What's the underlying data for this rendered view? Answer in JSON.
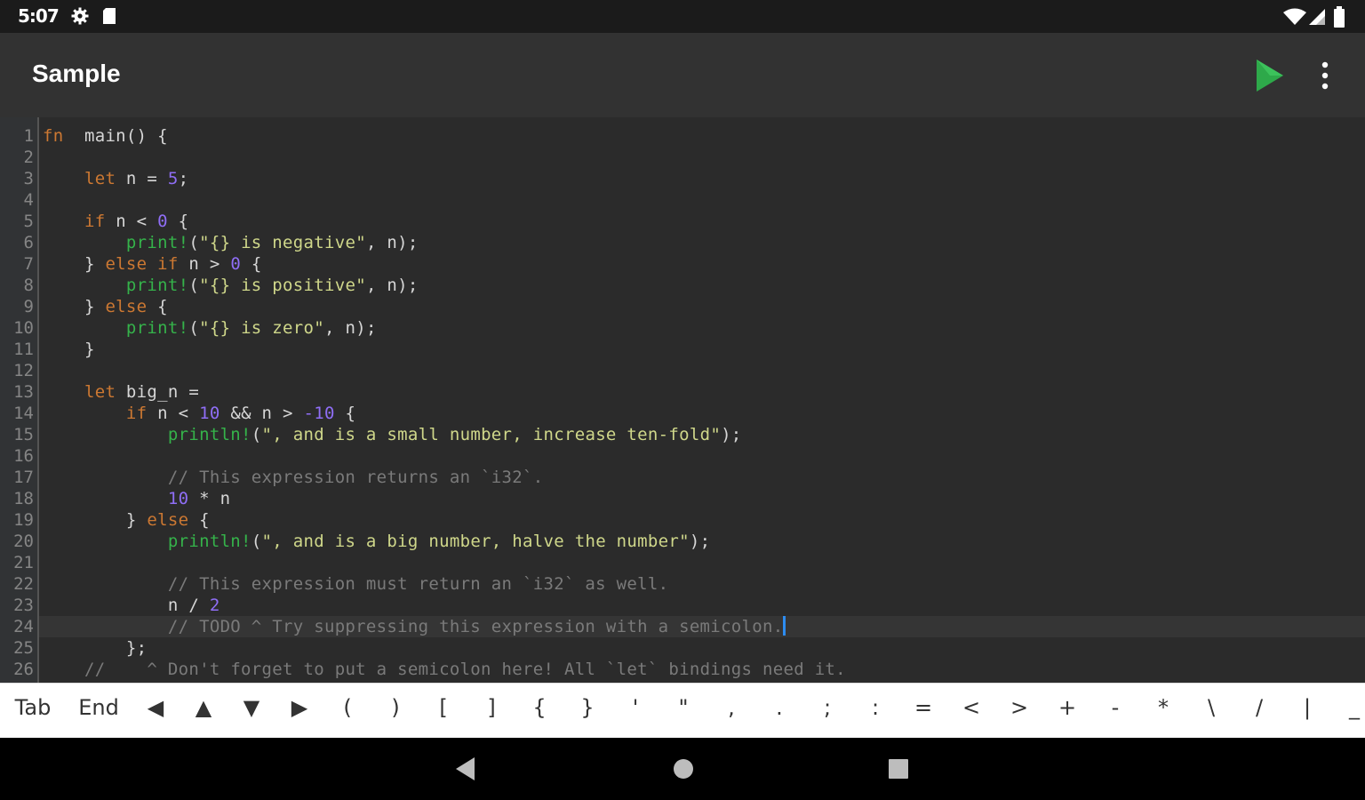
{
  "status_bar": {
    "time": "5:07",
    "icons": [
      "settings-gear-icon",
      "sd-card-icon",
      "wifi-icon",
      "cell-signal-icon",
      "battery-icon"
    ]
  },
  "app_bar": {
    "title": "Sample",
    "run_icon": "play-icon",
    "menu_icon": "more-vert-icon",
    "run_color": "#2ea94a"
  },
  "editor": {
    "line_numbers": [
      "1",
      "2",
      "3",
      "4",
      "5",
      "6",
      "7",
      "8",
      "9",
      "10",
      "11",
      "12",
      "13",
      "14",
      "15",
      "16",
      "17",
      "18",
      "19",
      "20",
      "21",
      "22",
      "23",
      "24",
      "25",
      "26"
    ],
    "current_line": 24,
    "code_lines": [
      [
        [
          "kw",
          "fn"
        ],
        [
          "",
          "  main() {"
        ]
      ],
      [],
      [
        [
          "",
          "    "
        ],
        [
          "kw",
          "let"
        ],
        [
          "",
          " n = "
        ],
        [
          "num",
          "5"
        ],
        [
          "",
          ";"
        ]
      ],
      [],
      [
        [
          "",
          "    "
        ],
        [
          "kw",
          "if"
        ],
        [
          "",
          " n < "
        ],
        [
          "num",
          "0"
        ],
        [
          "",
          " {"
        ]
      ],
      [
        [
          "",
          "        "
        ],
        [
          "mac",
          "print!"
        ],
        [
          "",
          "("
        ],
        [
          "str",
          "\"{} is negative\""
        ],
        [
          "",
          ", n);"
        ]
      ],
      [
        [
          "",
          "    } "
        ],
        [
          "kw",
          "else if"
        ],
        [
          "",
          " n > "
        ],
        [
          "num",
          "0"
        ],
        [
          "",
          " {"
        ]
      ],
      [
        [
          "",
          "        "
        ],
        [
          "mac",
          "print!"
        ],
        [
          "",
          "("
        ],
        [
          "str",
          "\"{} is positive\""
        ],
        [
          "",
          ", n);"
        ]
      ],
      [
        [
          "",
          "    } "
        ],
        [
          "kw",
          "else"
        ],
        [
          "",
          " {"
        ]
      ],
      [
        [
          "",
          "        "
        ],
        [
          "mac",
          "print!"
        ],
        [
          "",
          "("
        ],
        [
          "str",
          "\"{} is zero\""
        ],
        [
          "",
          ", n);"
        ]
      ],
      [
        [
          "",
          "    }"
        ]
      ],
      [],
      [
        [
          "",
          "    "
        ],
        [
          "kw",
          "let"
        ],
        [
          "",
          " big_n ="
        ]
      ],
      [
        [
          "",
          "        "
        ],
        [
          "kw",
          "if"
        ],
        [
          "",
          " n < "
        ],
        [
          "num",
          "10"
        ],
        [
          "",
          " && n > "
        ],
        [
          "num",
          "-10"
        ],
        [
          "",
          " {"
        ]
      ],
      [
        [
          "",
          "            "
        ],
        [
          "mac",
          "println!"
        ],
        [
          "",
          "("
        ],
        [
          "str",
          "\", and is a small number, increase ten-fold\""
        ],
        [
          "",
          ");"
        ]
      ],
      [],
      [
        [
          "",
          "            "
        ],
        [
          "cmt",
          "// This expression returns an `i32`."
        ]
      ],
      [
        [
          "",
          "            "
        ],
        [
          "num",
          "10"
        ],
        [
          "",
          " * n"
        ]
      ],
      [
        [
          "",
          "        } "
        ],
        [
          "kw",
          "else"
        ],
        [
          "",
          " {"
        ]
      ],
      [
        [
          "",
          "            "
        ],
        [
          "mac",
          "println!"
        ],
        [
          "",
          "("
        ],
        [
          "str",
          "\", and is a big number, halve the number\""
        ],
        [
          "",
          ");"
        ]
      ],
      [],
      [
        [
          "",
          "            "
        ],
        [
          "cmt",
          "// This expression must return an `i32` as well."
        ]
      ],
      [
        [
          "",
          "            n / "
        ],
        [
          "num",
          "2"
        ]
      ],
      [
        [
          "",
          "            "
        ],
        [
          "cmt",
          "// TODO ^ Try suppressing this expression with a semicolon."
        ]
      ],
      [
        [
          "",
          "        };"
        ]
      ],
      [
        [
          "",
          "    "
        ],
        [
          "cmt",
          "//    ^ Don't forget to put a semicolon here! All `let` bindings need it."
        ]
      ]
    ]
  },
  "extra_keys": [
    "Tab",
    "End",
    "◀",
    "▲",
    "▼",
    "▶",
    "(",
    ")",
    "[",
    "]",
    "{",
    "}",
    "'",
    "\"",
    ",",
    ".",
    ";",
    ":",
    "=",
    "<",
    ">",
    "+",
    "-",
    "*",
    "\\",
    "/",
    "|",
    "_"
  ],
  "nav_bar": {
    "icons": [
      "back-icon",
      "home-icon",
      "recents-icon"
    ]
  }
}
